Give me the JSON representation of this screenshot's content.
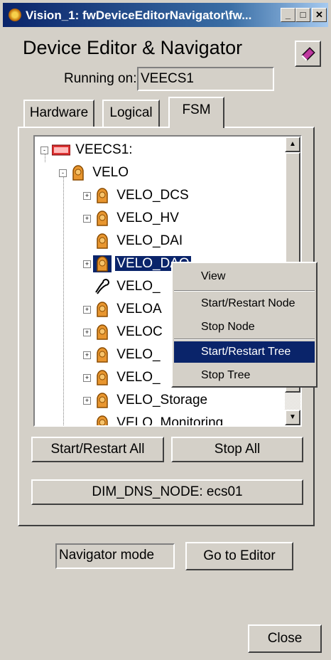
{
  "window": {
    "title": "Vision_1: fwDeviceEditorNavigator\\fw...",
    "minimize": "_",
    "maximize": "□",
    "close": "✕"
  },
  "app": {
    "title": "Device Editor & Navigator"
  },
  "running_on": {
    "label": "Running on:",
    "value": "VEECS1"
  },
  "tabs": [
    {
      "label": "Hardware",
      "active": false
    },
    {
      "label": "Logical",
      "active": false
    },
    {
      "label": "FSM",
      "active": true
    }
  ],
  "tree": {
    "root": "VEECS1:",
    "items": [
      {
        "label": "VELO",
        "expander": "-"
      },
      {
        "label": "VELO_DCS",
        "expander": "+"
      },
      {
        "label": "VELO_HV",
        "expander": "+"
      },
      {
        "label": "VELO_DAI",
        "expander": ""
      },
      {
        "label": "VELO_DAQ",
        "expander": "+",
        "selected": true
      },
      {
        "label": "VELO_",
        "expander": ""
      },
      {
        "label": "VELOA",
        "expander": "+"
      },
      {
        "label": "VELOC",
        "expander": "+"
      },
      {
        "label": "VELO_",
        "expander": "+"
      },
      {
        "label": "VELO_",
        "expander": "+"
      },
      {
        "label": "VELO_Storage",
        "expander": "+"
      },
      {
        "label": "VELO_Monitoring",
        "expander": ""
      }
    ]
  },
  "context_menu": {
    "items": [
      "View",
      "Start/Restart Node",
      "Stop Node",
      "Start/Restart Tree",
      "Stop Tree"
    ],
    "highlighted": "Start/Restart Tree"
  },
  "buttons": {
    "start_restart_all": "Start/Restart All",
    "stop_all": "Stop All",
    "dim_dns": "DIM_DNS_NODE: ecs01",
    "go_to_editor": "Go to Editor",
    "close": "Close"
  },
  "mode": {
    "value": "Navigator mode"
  },
  "colors": {
    "selection": "#0a246a",
    "window_bg": "#d4d0c8",
    "node_icon": "#e8962f"
  }
}
